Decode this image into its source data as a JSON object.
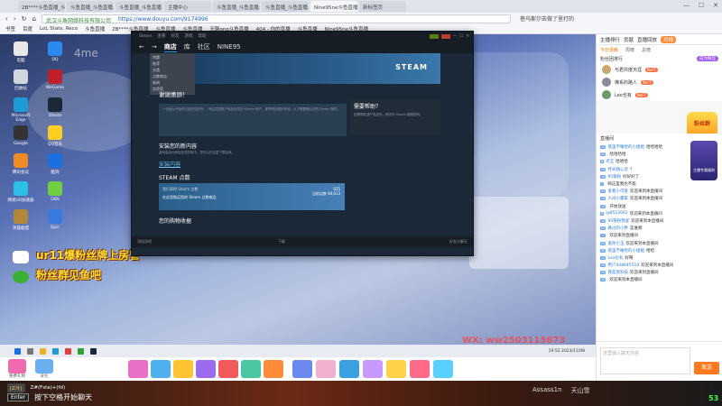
{
  "browser": {
    "tabs": [
      "2B****斗鱼直播_斗鱼直...",
      "斗鱼直播_斗鱼直播...",
      "斗鱼直播_斗鱼直播...",
      "主播中心",
      "斗鱼直播_斗鱼直播...",
      "斗鱼直播_斗鱼直播...",
      "Nine95ne斗鱼直播_...",
      "新标签页"
    ],
    "active_tab": 6,
    "address_secure": "武汉斗鱼网络科技有限公司",
    "address_url": "https://www.douyu.com/9174996",
    "address_right": "蓓乌斯尔去做了里打的",
    "bookmarks": [
      "书签",
      "百度",
      "LoL Stats, Reco",
      "斗鱼直播",
      "2B****斗鱼直播",
      "斗鱼直播",
      "斗鱼直播",
      "无聊ono斗鱼直播",
      "404 - 你的直播",
      "斗鱼直播",
      "Nine95ne斗鱼直播"
    ]
  },
  "stream": {
    "watermark": "4me",
    "overlay_line1": "ur11爆粉丝牌上房管",
    "overlay_line2": "粉丝群见鱼吧",
    "wx_text": "WX: ww2503115873",
    "desktop_icons": [
      "电脑",
      "QQ",
      "回收站",
      "WeGame",
      "Microsoft Edge",
      "Steam",
      "Google",
      "QQ音乐",
      "腾讯会议",
      "酷狗",
      "网易UU加速器",
      "OBS",
      "英雄联盟",
      "Epic"
    ]
  },
  "steam": {
    "top_menu": [
      "Steam",
      "查看",
      "好友",
      "游戏",
      "帮助"
    ],
    "nav_store": "商店",
    "nav_library": "库",
    "nav_community": "社区",
    "nav_user": "NINE95",
    "menu_items": [
      "特惠",
      "推荐",
      "分类",
      "点数商店",
      "新闻",
      "实验室"
    ],
    "logo": "STEAM",
    "welcome": "谢谢惠顾！",
    "msg_text": "一切就从开始时已经完成好你 ... 请注意将账户添加至您的 Steam 帐户，即享受到更好体验，以下需要确认您的 Steam 邮件。",
    "help_title": "需要帮助？",
    "help_text": "如需帮助或产品支持，请访问 Steam 客服官网。",
    "section_install": "安装您的新内容",
    "section_install_sub": "游戏会自动添加至您的库中，您可以在这里下载游戏。",
    "install_link": "安装内容",
    "points_title": "STEAM 点数",
    "points_line1": "我们获得 Steam 点数",
    "points_line2": "在这里购买您的 Steam 点数商品",
    "points_value": "835",
    "points_total": "当前点数 48,613",
    "collect_title": "您的购物收据",
    "bottom_left": "添加游戏",
    "bottom_mid": "下载",
    "bottom_right": "好友与聊天"
  },
  "os_taskbar": {
    "clock": "19:52 2023/11/08"
  },
  "gifts": {
    "left": [
      {
        "label": "免费礼物"
      },
      {
        "label": "背包"
      }
    ],
    "colors": [
      "#e86fc8",
      "#4fb0f0",
      "#ffc233",
      "#9a6af0",
      "#f05a5a",
      "#48c8a0",
      "#ff8a3a",
      "#6a8af0",
      "#f0b0d0",
      "#3aa0e0",
      "#c89aff",
      "#ffd24a",
      "#ff6a8a",
      "#5ad0ff"
    ]
  },
  "bottom_bar": {
    "chip": "[Z斗]",
    "row1_text": "Z#(Fsta)+(fd)",
    "key": "Enter",
    "row2_text": "按下空格开始聊天",
    "right_items": [
      "Assass1n",
      "天山雪"
    ],
    "fps": "53"
  },
  "sidebar": {
    "top_items": [
      "主播排行",
      "贡献",
      "直播回放"
    ],
    "top_pill": "月榜",
    "tabs": [
      "今日贡献",
      "周榜",
      "总榜"
    ],
    "rank_title": "粉丝团排行",
    "rank_btn": "成为粉丝",
    "ranks": [
      {
        "name": "与君共度天涯",
        "tag": "NoFF"
      },
      {
        "name": "佛系的路人",
        "tag": "NoFF"
      },
      {
        "name": "Leo也有",
        "tag": "NoFF"
      }
    ],
    "fan_badge": "粉丝群",
    "promo": "主播专属福利",
    "chat_head": "直播间",
    "chat": [
      {
        "lv": "19",
        "name": "夜里不睡觉的小姐姐",
        "text": "哈哈哈哈"
      },
      {
        "lv": "20",
        "name": "",
        "text": "哈哈哈哈"
      },
      {
        "lv": "8",
        "name": "老王",
        "text": "哈哈哈"
      },
      {
        "lv": "13",
        "name": "月光随心灵",
        "text": "？"
      },
      {
        "lv": "10",
        "name": "95铁粉",
        "text": "好好好了"
      },
      {
        "lv": "7",
        "name": "",
        "text": "啊这里我也不能"
      },
      {
        "lv": "23",
        "name": "爱看小可爱",
        "text": "欢迎来到本直播间"
      },
      {
        "lv": "15",
        "name": "人间小赢家",
        "text": "欢迎来到本直播间"
      },
      {
        "lv": "12",
        "name": "",
        "text": "开始放送"
      },
      {
        "lv": "9",
        "name": "@8512062",
        "text": "欢迎来到本直播间"
      },
      {
        "lv": "18",
        "name": "95铁粉我爱",
        "text": "欢迎来到本直播间"
      },
      {
        "lv": "21",
        "name": "路过的小胖",
        "text": "是谁啊"
      },
      {
        "lv": "17",
        "name": "",
        "text": "欢迎来到直播间"
      },
      {
        "lv": "24",
        "name": "爱你小玉",
        "text": "欢迎来到本直播间"
      },
      {
        "lv": "30",
        "name": "夜里不睡觉的小姐姐",
        "text": "哈哈"
      },
      {
        "lv": "11",
        "name": "Leo也有",
        "text": "好嘞"
      },
      {
        "lv": "16",
        "name": "用户448645519",
        "text": "欢迎来到本直播间"
      },
      {
        "lv": "14",
        "name": "我是黑科技",
        "text": "欢迎来到直播间"
      },
      {
        "lv": "19",
        "name": "",
        "text": "欢迎来到本直播间"
      }
    ],
    "input_placeholder": "这里输入聊天内容",
    "send_label": "发送"
  }
}
